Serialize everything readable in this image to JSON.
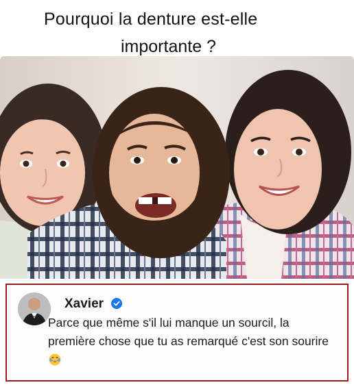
{
  "title": {
    "line1": "Pourquoi la denture est-elle",
    "line2": "importante ?"
  },
  "photo": {
    "icon": "family-photo"
  },
  "comment": {
    "username": "Xavier",
    "verified_icon": "verified-badge-icon",
    "text": "Parce que même s'il lui manque un sourcil, la première chose que tu as remarqué c'est son sourire",
    "emoji": "laughing-tears-emoji",
    "border_color": "#9c1b1b",
    "verified_color": "#1877f2"
  }
}
